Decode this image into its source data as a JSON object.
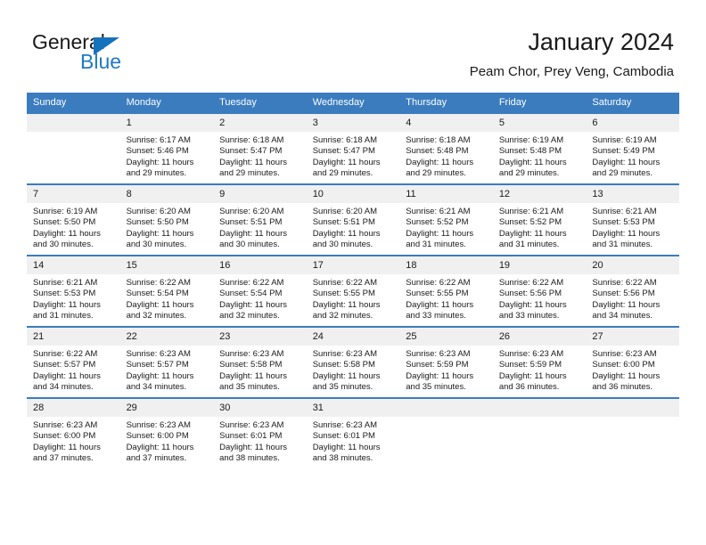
{
  "brand": {
    "name_part1": "General",
    "name_part2": "Blue",
    "triangle_color": "#1572bd",
    "blue_color": "#1f7ac4"
  },
  "header": {
    "title": "January 2024",
    "subtitle": "Peam Chor, Prey Veng, Cambodia"
  },
  "theme": {
    "header_row_color": "#3b7cbf",
    "daynum_bg": "#f0f0f0",
    "text_color": "#1a1a1a"
  },
  "calendar": {
    "weekday_headers": [
      "Sunday",
      "Monday",
      "Tuesday",
      "Wednesday",
      "Thursday",
      "Friday",
      "Saturday"
    ],
    "weeks": [
      [
        {
          "day": "",
          "sunrise": "",
          "sunset": "",
          "daylight1": "",
          "daylight2": "",
          "blank": true
        },
        {
          "day": "1",
          "sunrise": "Sunrise: 6:17 AM",
          "sunset": "Sunset: 5:46 PM",
          "daylight1": "Daylight: 11 hours",
          "daylight2": "and 29 minutes."
        },
        {
          "day": "2",
          "sunrise": "Sunrise: 6:18 AM",
          "sunset": "Sunset: 5:47 PM",
          "daylight1": "Daylight: 11 hours",
          "daylight2": "and 29 minutes."
        },
        {
          "day": "3",
          "sunrise": "Sunrise: 6:18 AM",
          "sunset": "Sunset: 5:47 PM",
          "daylight1": "Daylight: 11 hours",
          "daylight2": "and 29 minutes."
        },
        {
          "day": "4",
          "sunrise": "Sunrise: 6:18 AM",
          "sunset": "Sunset: 5:48 PM",
          "daylight1": "Daylight: 11 hours",
          "daylight2": "and 29 minutes."
        },
        {
          "day": "5",
          "sunrise": "Sunrise: 6:19 AM",
          "sunset": "Sunset: 5:48 PM",
          "daylight1": "Daylight: 11 hours",
          "daylight2": "and 29 minutes."
        },
        {
          "day": "6",
          "sunrise": "Sunrise: 6:19 AM",
          "sunset": "Sunset: 5:49 PM",
          "daylight1": "Daylight: 11 hours",
          "daylight2": "and 29 minutes."
        }
      ],
      [
        {
          "day": "7",
          "sunrise": "Sunrise: 6:19 AM",
          "sunset": "Sunset: 5:50 PM",
          "daylight1": "Daylight: 11 hours",
          "daylight2": "and 30 minutes."
        },
        {
          "day": "8",
          "sunrise": "Sunrise: 6:20 AM",
          "sunset": "Sunset: 5:50 PM",
          "daylight1": "Daylight: 11 hours",
          "daylight2": "and 30 minutes."
        },
        {
          "day": "9",
          "sunrise": "Sunrise: 6:20 AM",
          "sunset": "Sunset: 5:51 PM",
          "daylight1": "Daylight: 11 hours",
          "daylight2": "and 30 minutes."
        },
        {
          "day": "10",
          "sunrise": "Sunrise: 6:20 AM",
          "sunset": "Sunset: 5:51 PM",
          "daylight1": "Daylight: 11 hours",
          "daylight2": "and 30 minutes."
        },
        {
          "day": "11",
          "sunrise": "Sunrise: 6:21 AM",
          "sunset": "Sunset: 5:52 PM",
          "daylight1": "Daylight: 11 hours",
          "daylight2": "and 31 minutes."
        },
        {
          "day": "12",
          "sunrise": "Sunrise: 6:21 AM",
          "sunset": "Sunset: 5:52 PM",
          "daylight1": "Daylight: 11 hours",
          "daylight2": "and 31 minutes."
        },
        {
          "day": "13",
          "sunrise": "Sunrise: 6:21 AM",
          "sunset": "Sunset: 5:53 PM",
          "daylight1": "Daylight: 11 hours",
          "daylight2": "and 31 minutes."
        }
      ],
      [
        {
          "day": "14",
          "sunrise": "Sunrise: 6:21 AM",
          "sunset": "Sunset: 5:53 PM",
          "daylight1": "Daylight: 11 hours",
          "daylight2": "and 31 minutes."
        },
        {
          "day": "15",
          "sunrise": "Sunrise: 6:22 AM",
          "sunset": "Sunset: 5:54 PM",
          "daylight1": "Daylight: 11 hours",
          "daylight2": "and 32 minutes."
        },
        {
          "day": "16",
          "sunrise": "Sunrise: 6:22 AM",
          "sunset": "Sunset: 5:54 PM",
          "daylight1": "Daylight: 11 hours",
          "daylight2": "and 32 minutes."
        },
        {
          "day": "17",
          "sunrise": "Sunrise: 6:22 AM",
          "sunset": "Sunset: 5:55 PM",
          "daylight1": "Daylight: 11 hours",
          "daylight2": "and 32 minutes."
        },
        {
          "day": "18",
          "sunrise": "Sunrise: 6:22 AM",
          "sunset": "Sunset: 5:55 PM",
          "daylight1": "Daylight: 11 hours",
          "daylight2": "and 33 minutes."
        },
        {
          "day": "19",
          "sunrise": "Sunrise: 6:22 AM",
          "sunset": "Sunset: 5:56 PM",
          "daylight1": "Daylight: 11 hours",
          "daylight2": "and 33 minutes."
        },
        {
          "day": "20",
          "sunrise": "Sunrise: 6:22 AM",
          "sunset": "Sunset: 5:56 PM",
          "daylight1": "Daylight: 11 hours",
          "daylight2": "and 34 minutes."
        }
      ],
      [
        {
          "day": "21",
          "sunrise": "Sunrise: 6:22 AM",
          "sunset": "Sunset: 5:57 PM",
          "daylight1": "Daylight: 11 hours",
          "daylight2": "and 34 minutes."
        },
        {
          "day": "22",
          "sunrise": "Sunrise: 6:23 AM",
          "sunset": "Sunset: 5:57 PM",
          "daylight1": "Daylight: 11 hours",
          "daylight2": "and 34 minutes."
        },
        {
          "day": "23",
          "sunrise": "Sunrise: 6:23 AM",
          "sunset": "Sunset: 5:58 PM",
          "daylight1": "Daylight: 11 hours",
          "daylight2": "and 35 minutes."
        },
        {
          "day": "24",
          "sunrise": "Sunrise: 6:23 AM",
          "sunset": "Sunset: 5:58 PM",
          "daylight1": "Daylight: 11 hours",
          "daylight2": "and 35 minutes."
        },
        {
          "day": "25",
          "sunrise": "Sunrise: 6:23 AM",
          "sunset": "Sunset: 5:59 PM",
          "daylight1": "Daylight: 11 hours",
          "daylight2": "and 35 minutes."
        },
        {
          "day": "26",
          "sunrise": "Sunrise: 6:23 AM",
          "sunset": "Sunset: 5:59 PM",
          "daylight1": "Daylight: 11 hours",
          "daylight2": "and 36 minutes."
        },
        {
          "day": "27",
          "sunrise": "Sunrise: 6:23 AM",
          "sunset": "Sunset: 6:00 PM",
          "daylight1": "Daylight: 11 hours",
          "daylight2": "and 36 minutes."
        }
      ],
      [
        {
          "day": "28",
          "sunrise": "Sunrise: 6:23 AM",
          "sunset": "Sunset: 6:00 PM",
          "daylight1": "Daylight: 11 hours",
          "daylight2": "and 37 minutes."
        },
        {
          "day": "29",
          "sunrise": "Sunrise: 6:23 AM",
          "sunset": "Sunset: 6:00 PM",
          "daylight1": "Daylight: 11 hours",
          "daylight2": "and 37 minutes."
        },
        {
          "day": "30",
          "sunrise": "Sunrise: 6:23 AM",
          "sunset": "Sunset: 6:01 PM",
          "daylight1": "Daylight: 11 hours",
          "daylight2": "and 38 minutes."
        },
        {
          "day": "31",
          "sunrise": "Sunrise: 6:23 AM",
          "sunset": "Sunset: 6:01 PM",
          "daylight1": "Daylight: 11 hours",
          "daylight2": "and 38 minutes."
        },
        {
          "day": "",
          "sunrise": "",
          "sunset": "",
          "daylight1": "",
          "daylight2": "",
          "blank": true
        },
        {
          "day": "",
          "sunrise": "",
          "sunset": "",
          "daylight1": "",
          "daylight2": "",
          "blank": true
        },
        {
          "day": "",
          "sunrise": "",
          "sunset": "",
          "daylight1": "",
          "daylight2": "",
          "blank": true
        }
      ]
    ]
  }
}
